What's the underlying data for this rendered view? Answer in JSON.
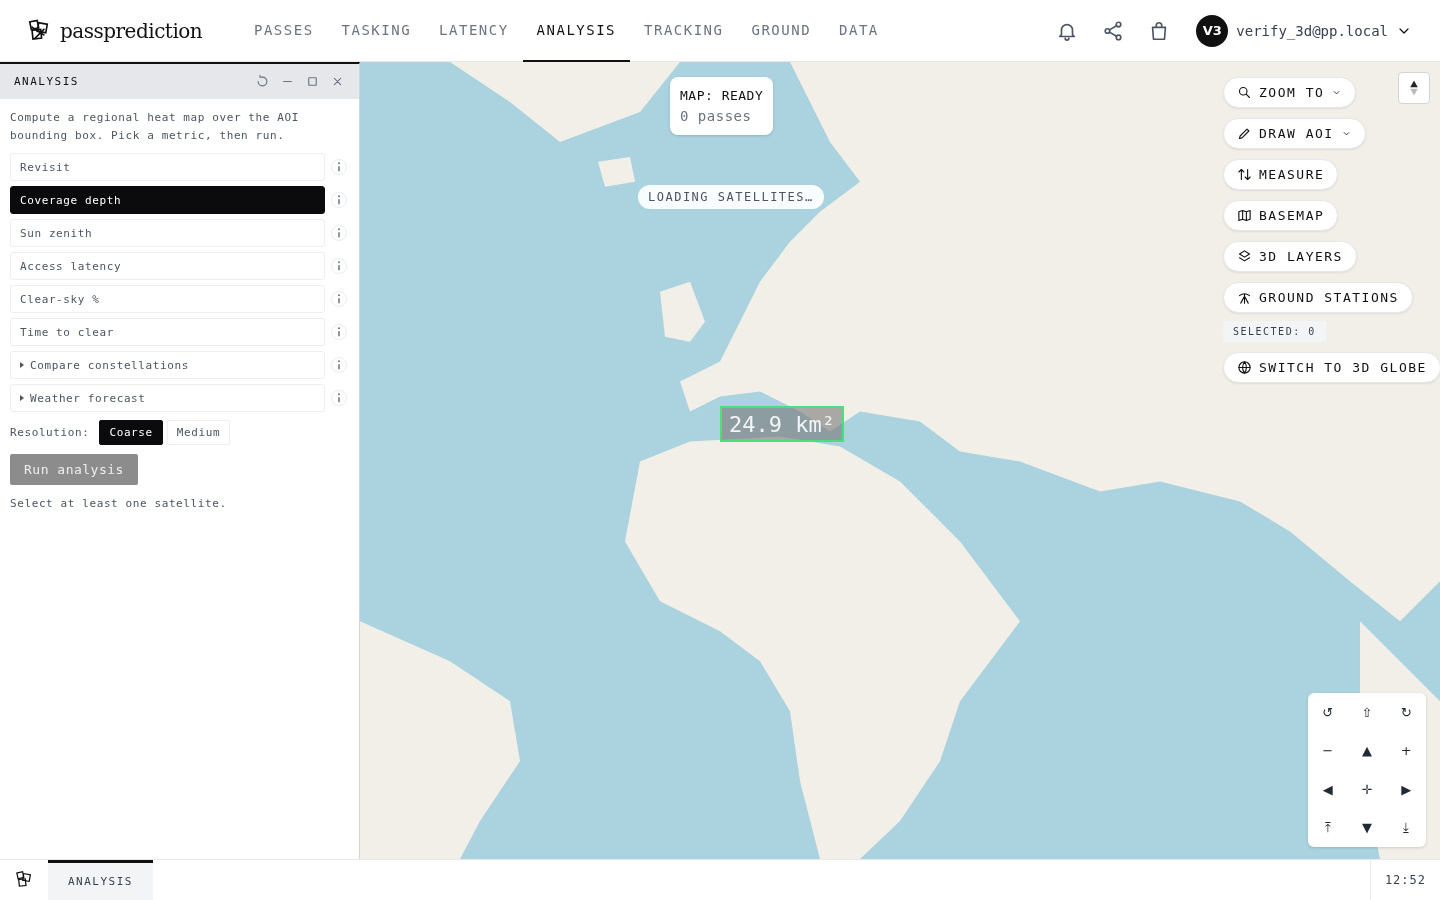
{
  "app": {
    "name": "passprediction"
  },
  "nav": [
    {
      "label": "PASSES",
      "selected": false
    },
    {
      "label": "TASKING",
      "selected": false
    },
    {
      "label": "LATENCY",
      "selected": false
    },
    {
      "label": "ANALYSIS",
      "selected": true
    },
    {
      "label": "TRACKING",
      "selected": false
    },
    {
      "label": "GROUND",
      "selected": false
    },
    {
      "label": "DATA",
      "selected": false
    }
  ],
  "user": {
    "initials": "V3",
    "email": "verify_3d@pp.local"
  },
  "panel": {
    "title": "ANALYSIS",
    "description": "Compute a regional heat map over the AOI bounding box. Pick a metric, then run.",
    "metrics": [
      {
        "kind": "metric",
        "label": "Revisit",
        "selected": false
      },
      {
        "kind": "metric",
        "label": "Coverage depth",
        "selected": true
      },
      {
        "kind": "metric",
        "label": "Sun zenith",
        "selected": false
      },
      {
        "kind": "metric",
        "label": "Access latency",
        "selected": false
      },
      {
        "kind": "metric",
        "label": "Clear-sky %",
        "selected": false
      },
      {
        "kind": "metric",
        "label": "Time to clear",
        "selected": false
      },
      {
        "kind": "expander",
        "label": "Compare constellations",
        "expanded": false
      },
      {
        "kind": "expander",
        "label": "Weather forecast",
        "expanded": false
      }
    ],
    "resolution": {
      "label": "Resolution:",
      "options": [
        {
          "label": "Coarse",
          "selected": true
        },
        {
          "label": "Medium",
          "selected": false
        }
      ]
    },
    "run_button": {
      "label": "Run analysis",
      "disabled": true
    },
    "hint": "Select at least one satellite."
  },
  "map": {
    "status": {
      "title": "MAP: READY",
      "subtitle": "0 passes"
    },
    "loading": "LOADING SATELLITES…",
    "area_readout": "24.9 km²",
    "tools": [
      {
        "kind": "search",
        "label": "ZOOM TO",
        "dropdown": true
      },
      {
        "kind": "pencil",
        "label": "DRAW AOI",
        "dropdown": true
      },
      {
        "kind": "arrows",
        "label": "MEASURE",
        "dropdown": false
      },
      {
        "kind": "map",
        "label": "BASEMAP",
        "dropdown": false
      },
      {
        "kind": "layers",
        "label": "3D LAYERS",
        "dropdown": false
      },
      {
        "kind": "antenna",
        "label": "GROUND STATIONS",
        "dropdown": false
      }
    ],
    "selected_count": "SELECTED: 0",
    "globe_button": {
      "kind": "globe",
      "label": "SWITCH TO 3D GLOBE"
    },
    "pad": [
      "↺",
      "⇧",
      "↻",
      "−",
      "▲",
      "+",
      "◀",
      "✛",
      "▶",
      "⤒",
      "▼",
      "⤓"
    ]
  },
  "taskbar": {
    "items": [
      {
        "label": "ANALYSIS",
        "selected": true
      }
    ],
    "clock": "12:52"
  }
}
